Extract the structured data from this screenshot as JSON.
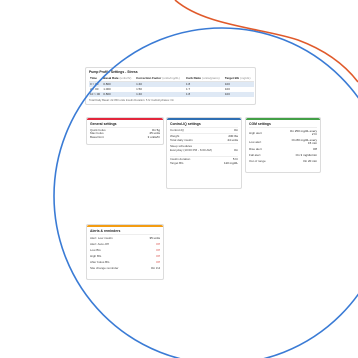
{
  "pump_profile": {
    "title": "Pump Profile Settings - Stress",
    "columns": [
      {
        "name": "Time",
        "unit": ""
      },
      {
        "name": "Basal Rate",
        "unit": "(units/hr)"
      },
      {
        "name": "Correction Factor",
        "unit": "(units/mg/dL)"
      },
      {
        "name": "Carb Ratio",
        "unit": "(units/grams)"
      },
      {
        "name": "Target BG",
        "unit": "(mg/dL)"
      }
    ],
    "rows": [
      [
        "0 > 00",
        "0.800",
        "1:40",
        "1:8",
        "100"
      ],
      [
        "2 > 00",
        "1.000",
        "1:50",
        "1:7",
        "100"
      ],
      [
        "10 > 00",
        "0.800",
        "1:40",
        "1:8",
        "100"
      ]
    ],
    "footer": "Total Daily Basal: 22.050 units   Insulin Duration: 5 hr   Carbohydrates: On"
  },
  "general": {
    "title": "General settings",
    "rows": [
      {
        "label": "Quick bolus",
        "value": "On 5g"
      },
      {
        "label": "Max bolus",
        "value": "25 units"
      },
      {
        "label": "Basal limit",
        "value": "3 units/hr"
      }
    ]
  },
  "control": {
    "title": "Control-IQ settings",
    "rows": [
      {
        "label": "Control-IQ",
        "value": "On"
      },
      {
        "label": "Weight",
        "value": "230 lbs"
      },
      {
        "label": "Total daily insulin",
        "value": "24 units"
      }
    ],
    "sleep_label": "Sleep schedules",
    "sleep_value": "Everyday (10:00 PM - 6:00 AM)",
    "sleep_state": "On",
    "rows2": [
      {
        "label": "Insulin duration",
        "value": "5 hr"
      },
      {
        "label": "Target BG",
        "value": "110 mg/dL"
      }
    ]
  },
  "cgm": {
    "title": "CGM settings",
    "rows": [
      {
        "label": "High alert",
        "value": "On 250 mg/dL every 2 hr"
      },
      {
        "label": "Low alert",
        "value": "On 80 mg/dL every 15 min"
      },
      {
        "label": "Rise alert",
        "value": "Off"
      },
      {
        "label": "Fall alert",
        "value": "On 3 mg/dL/min"
      },
      {
        "label": "Out of range",
        "value": "On 20 min"
      }
    ]
  },
  "alerts": {
    "title": "Alerts & reminders",
    "rows": [
      {
        "label": "Alert: Low insulin",
        "value": "35 units",
        "warn": false
      },
      {
        "label": "Alert: Auto-Off",
        "value": "Off",
        "warn": true
      },
      {
        "label": "Low BG",
        "value": "Off",
        "warn": true
      },
      {
        "label": "High BG",
        "value": "Off",
        "warn": true
      },
      {
        "label": "After bolus BG",
        "value": "Off",
        "warn": true
      },
      {
        "label": "Site change reminder",
        "value": "On 3 d",
        "warn": false
      }
    ]
  },
  "colors": {
    "general_accent": "#e3263c",
    "control_accent": "#2f6fb3",
    "cgm_accent": "#43a047",
    "alerts_accent": "#f39c12",
    "circle_outline": "#3a7bd5",
    "curve_accent": "#e05a2b"
  }
}
